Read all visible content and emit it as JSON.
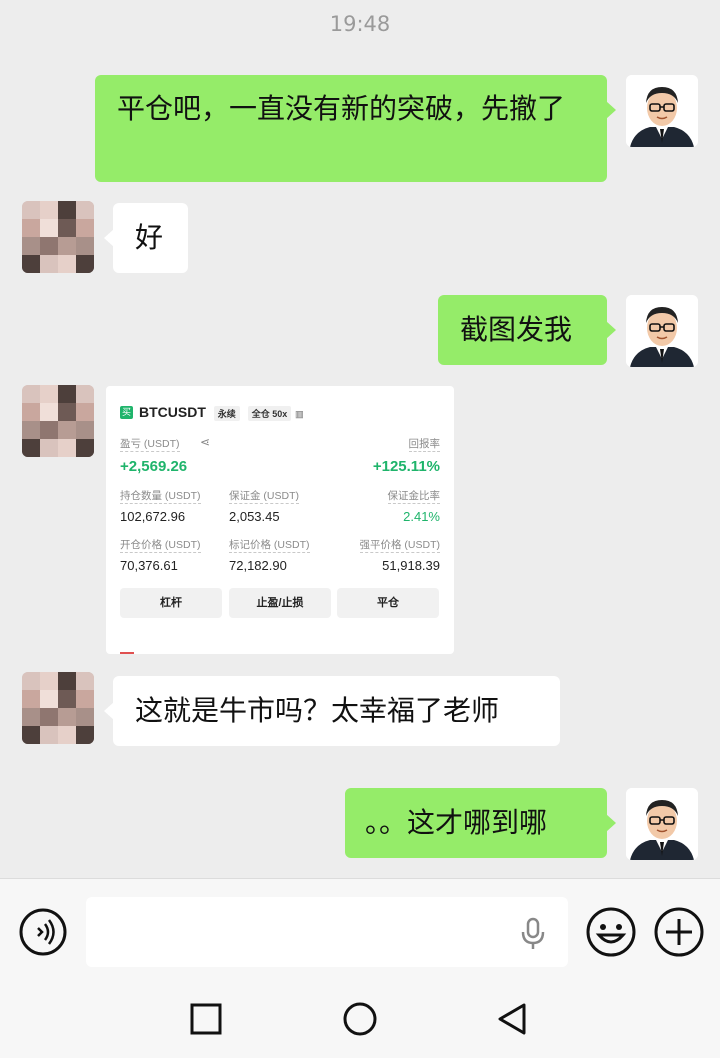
{
  "status": {
    "time": "19:48"
  },
  "messages": [
    {
      "sender": "me",
      "text": "平仓吧，一直没有新的突破，先撤了"
    },
    {
      "sender": "other",
      "text": "好"
    },
    {
      "sender": "me",
      "text": "截图发我"
    },
    {
      "sender": "other",
      "type": "image"
    },
    {
      "sender": "other",
      "text": "这就是牛市吗？太幸福了老师"
    },
    {
      "sender": "me",
      "text": "。。这才哪到哪"
    }
  ],
  "position_card": {
    "logo": "买",
    "symbol": "BTCUSDT",
    "contract_type": "永续",
    "margin_mode": "全仓 50x",
    "pnl_label": "盈亏 (USDT)",
    "pnl_value": "+2,569.26",
    "roe_label": "回报率",
    "roe_value": "+125.11%",
    "size_label": "持仓数量 (USDT)",
    "size_value": "102,672.96",
    "margin_label": "保证金 (USDT)",
    "margin_value": "2,053.45",
    "margin_ratio_label": "保证金比率",
    "margin_ratio_value": "2.41%",
    "entry_label": "开仓价格 (USDT)",
    "entry_value": "70,376.61",
    "mark_label": "标记价格 (USDT)",
    "mark_value": "72,182.90",
    "liq_label": "强平价格 (USDT)",
    "liq_value": "51,918.39",
    "buttons": [
      "杠杆",
      "止盈/止损",
      "平仓"
    ]
  },
  "input_bar": {
    "voice_icon": "voice-input-icon",
    "mic_icon": "microphone-icon",
    "emoji_icon": "emoji-icon",
    "plus_icon": "plus-icon"
  },
  "nav_bar": {
    "icons": [
      "recent-apps-icon",
      "home-icon",
      "back-icon"
    ]
  },
  "colors": {
    "my_bubble": "#95ec69",
    "their_bubble": "#ffffff",
    "background": "#ededed",
    "profit_green": "#1fb46b"
  }
}
